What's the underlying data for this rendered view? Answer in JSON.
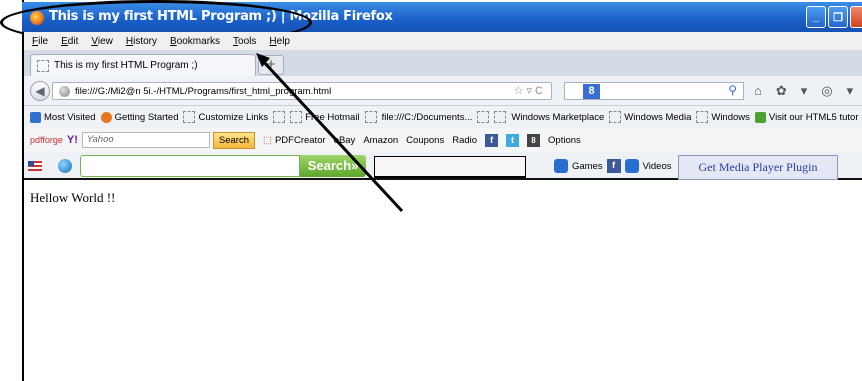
{
  "window": {
    "title": "This is my first HTML Program ;) | Mozilla Firefox",
    "buttons": {
      "minimize": "_",
      "restore": "❐"
    }
  },
  "menubar": {
    "items": [
      {
        "label": "File"
      },
      {
        "label": "Edit"
      },
      {
        "label": "View"
      },
      {
        "label": "History"
      },
      {
        "label": "Bookmarks"
      },
      {
        "label": "Tools"
      },
      {
        "label": "Help"
      }
    ]
  },
  "tabs": {
    "active": "This is my first HTML Program ;)",
    "new_tab": "+"
  },
  "navbar": {
    "url": "file:///G:/Mi2@n 5i.-/HTML/Programs/first_html_program.html",
    "url_icons": "☆ ▿ C",
    "search_engine": "8"
  },
  "bookmarks": [
    {
      "label": "Most Visited",
      "icon_color": "#2f6fd0"
    },
    {
      "label": "Getting Started",
      "icon_color": "#e8761c"
    },
    {
      "label": "Customize Links",
      "icon_color": ""
    },
    {
      "label": "",
      "icon_color": ""
    },
    {
      "label": "Free Hotmail",
      "icon_color": ""
    },
    {
      "label": "",
      "icon_color": ""
    },
    {
      "label": "file:///C:/Documents...",
      "icon_color": ""
    },
    {
      "label": "",
      "icon_color": ""
    },
    {
      "label": "",
      "icon_color": ""
    },
    {
      "label": "Windows Marketplace",
      "icon_color": ""
    },
    {
      "label": "Windows Media",
      "icon_color": ""
    },
    {
      "label": "Windows",
      "icon_color": ""
    },
    {
      "label": "Visit our HTML5 tutor",
      "icon_color": "#4aa030"
    }
  ],
  "yahoo_toolbar": {
    "pdfforge": "pdfforge",
    "yahoo_logo": "Y!",
    "search_placeholder": "Yahoo",
    "search_button": "Search",
    "items": [
      {
        "label": "PDFCreator"
      },
      {
        "label": "eBay"
      },
      {
        "label": "Amazon"
      },
      {
        "label": "Coupons"
      },
      {
        "label": "Radio"
      },
      {
        "label": "Options"
      }
    ]
  },
  "green_toolbar": {
    "search_button": "Search»",
    "games": "Games",
    "videos": "Videos",
    "media_plugin": "Get Media Player Plugin"
  },
  "page": {
    "body_text": "Hellow World !!"
  }
}
